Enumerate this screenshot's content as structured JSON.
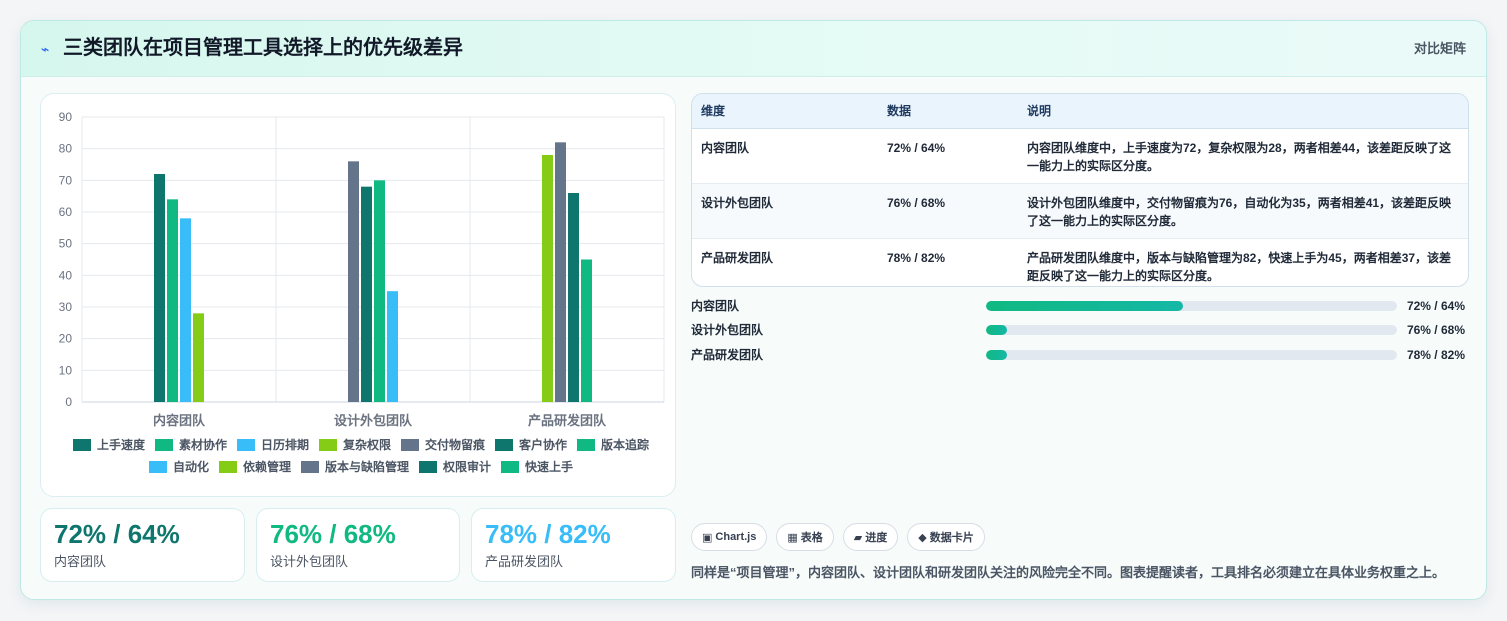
{
  "header": {
    "icon": "lightning-icon",
    "title": "三类团队在项目管理工具选择上的优先级差异",
    "tag": "对比矩阵"
  },
  "chart_data": {
    "type": "bar",
    "categories": [
      "内容团队",
      "设计外包团队",
      "产品研发团队"
    ],
    "ylim": [
      0,
      90
    ],
    "yticks": [
      0,
      10,
      20,
      30,
      40,
      50,
      60,
      70,
      80,
      90
    ],
    "grid": true,
    "legend_position": "bottom",
    "legend": [
      {
        "name": "上手速度",
        "color": "#0f766e"
      },
      {
        "name": "素材协作",
        "color": "#10b981"
      },
      {
        "name": "日历排期",
        "color": "#38bdf8"
      },
      {
        "name": "复杂权限",
        "color": "#84cc16"
      },
      {
        "name": "交付物留痕",
        "color": "#64748b"
      },
      {
        "name": "客户协作",
        "color": "#0f766e"
      },
      {
        "name": "版本追踪",
        "color": "#10b981"
      },
      {
        "name": "自动化",
        "color": "#38bdf8"
      },
      {
        "name": "依赖管理",
        "color": "#84cc16"
      },
      {
        "name": "版本与缺陷管理",
        "color": "#64748b"
      },
      {
        "name": "权限审计",
        "color": "#0f766e"
      },
      {
        "name": "快速上手",
        "color": "#10b981"
      }
    ],
    "series": [
      {
        "name": "上手速度",
        "color": "#0f766e",
        "values": [
          72,
          null,
          null
        ]
      },
      {
        "name": "素材协作",
        "color": "#10b981",
        "values": [
          64,
          null,
          null
        ]
      },
      {
        "name": "日历排期",
        "color": "#38bdf8",
        "values": [
          58,
          null,
          null
        ]
      },
      {
        "name": "复杂权限",
        "color": "#84cc16",
        "values": [
          28,
          null,
          null
        ]
      },
      {
        "name": "交付物留痕",
        "color": "#64748b",
        "values": [
          null,
          76,
          null
        ]
      },
      {
        "name": "客户协作",
        "color": "#0f766e",
        "values": [
          null,
          68,
          null
        ]
      },
      {
        "name": "版本追踪",
        "color": "#10b981",
        "values": [
          null,
          70,
          null
        ]
      },
      {
        "name": "自动化",
        "color": "#38bdf8",
        "values": [
          null,
          35,
          null
        ]
      },
      {
        "name": "依赖管理",
        "color": "#84cc16",
        "values": [
          null,
          null,
          78
        ]
      },
      {
        "name": "版本与缺陷管理",
        "color": "#64748b",
        "values": [
          null,
          null,
          82
        ]
      },
      {
        "name": "权限审计",
        "color": "#0f766e",
        "values": [
          null,
          null,
          66
        ]
      },
      {
        "name": "快速上手",
        "color": "#10b981",
        "values": [
          null,
          null,
          45
        ]
      }
    ]
  },
  "stats": [
    {
      "value": "72% / 64%",
      "label": "内容团队",
      "color": "#0f766e"
    },
    {
      "value": "76% / 68%",
      "label": "设计外包团队",
      "color": "#10b981"
    },
    {
      "value": "78% / 82%",
      "label": "产品研发团队",
      "color": "#38bdf8"
    }
  ],
  "table": {
    "headers": [
      "维度",
      "数据",
      "说明"
    ],
    "rows": [
      [
        "内容团队",
        "72% / 64%",
        "内容团队维度中，上手速度为72，复杂权限为28，两者相差44，该差距反映了这一能力上的实际区分度。"
      ],
      [
        "设计外包团队",
        "76% / 68%",
        "设计外包团队维度中，交付物留痕为76，自动化为35，两者相差41，该差距反映了这一能力上的实际区分度。"
      ],
      [
        "产品研发团队",
        "78% / 82%",
        "产品研发团队维度中，版本与缺陷管理为82，快速上手为45，两者相差37，该差距反映了这一能力上的实际区分度。"
      ]
    ]
  },
  "progress": [
    {
      "label": "内容团队",
      "value": "72% / 64%",
      "fill": 0.48
    },
    {
      "label": "设计外包团队",
      "value": "76% / 68%",
      "fill": 0.05
    },
    {
      "label": "产品研发团队",
      "value": "78% / 82%",
      "fill": 0.05
    }
  ],
  "chips": [
    {
      "icon": "▣",
      "label": "Chart.js"
    },
    {
      "icon": "▦",
      "label": "表格"
    },
    {
      "icon": "▰",
      "label": "进度"
    },
    {
      "icon": "◆",
      "label": "数据卡片"
    }
  ],
  "footnote": "同样是“项目管理”，内容团队、设计团队和研发团队关注的风险完全不同。图表提醒读者，工具排名必须建立在具体业务权重之上。"
}
